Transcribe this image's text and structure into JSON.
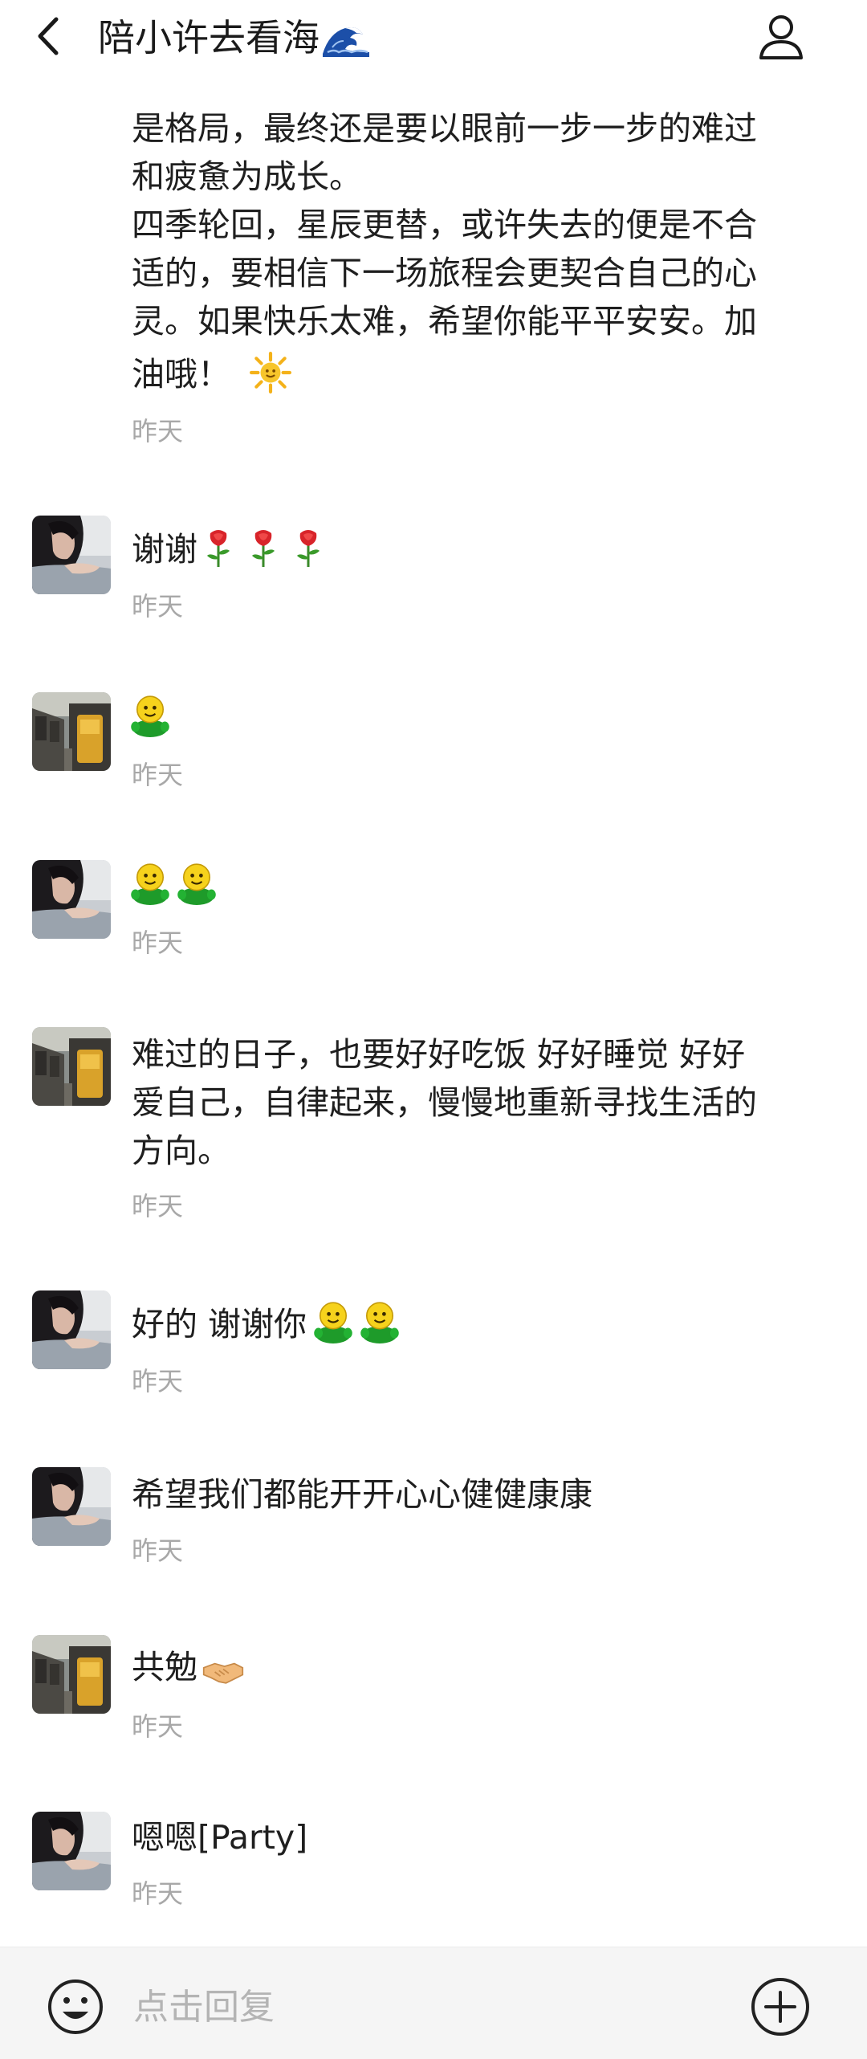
{
  "header": {
    "title": "陪小许去看海",
    "title_emoji": "wave-icon"
  },
  "messages": [
    {
      "sender": "other-girl",
      "text_lines": [
        "是格局，最终还是要以眼前一步一步的难过",
        "和疲惫为成长。",
        "四季轮回，星辰更替，或许失去的便是不合",
        "适的，要相信下一场旅程会更契合自己的心",
        "灵。如果快乐太难，希望你能平平安安。加",
        "油哦！"
      ],
      "emoji": "sun-icon",
      "time": "昨天"
    },
    {
      "sender": "girl",
      "text": "谢谢",
      "emoji": "rose-icon x3",
      "time": "昨天"
    },
    {
      "sender": "street",
      "text": "",
      "emoji": "green-smiley-icon",
      "time": "昨天"
    },
    {
      "sender": "girl",
      "text": "",
      "emoji": "green-smiley-icon x2",
      "time": "昨天"
    },
    {
      "sender": "street",
      "text_lines": [
        "难过的日子，也要好好吃饭 好好睡觉 好好",
        "爱自己，自律起来，慢慢地重新寻找生活的",
        "方向。"
      ],
      "time": "昨天"
    },
    {
      "sender": "girl",
      "text": "好的 谢谢你",
      "emoji": "green-smiley-icon x2",
      "time": "昨天"
    },
    {
      "sender": "girl",
      "text": "希望我们都能开开心心健健康康",
      "time": "昨天"
    },
    {
      "sender": "street",
      "text": "共勉",
      "emoji": "handshake-icon",
      "time": "昨天"
    },
    {
      "sender": "girl",
      "text": "嗯嗯[Party]",
      "time": "昨天"
    }
  ],
  "reply": {
    "placeholder": "点击回复",
    "emoji_button": "smiley-face-icon",
    "add_button": "plus-circle-icon"
  },
  "colors": {
    "text": "#1f1f1f",
    "time": "#a8a8a8",
    "reply_bar": "#f5f5f5",
    "placeholder": "#b4b4b4"
  }
}
